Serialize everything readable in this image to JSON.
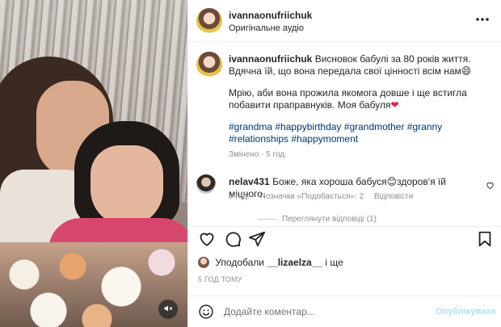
{
  "post": {
    "username": "ivannaonufriichuk",
    "audio": "Оригінальне аудіо",
    "caption_line1": "Висновок бабулі за 80 років життя. Вдячна їй, що вона передала свої цінності всім нам😄",
    "caption_line2": "Мрію, аби вона прожила якомога довше і ще встигла побавити праправнуків. Моя бабуля",
    "hashtags": "#grandma #happybirthday #grandmother #granny #relationships #happymoment",
    "edited": "Змінено · 5 год."
  },
  "comment": {
    "username": "nelav431",
    "text": "Боже, яка хороша бабуся😊здоров'я їй міцного.",
    "time": "4 год.",
    "likes": "Позначки «Подобається»: 2",
    "reply": "Відповісти",
    "view_replies": "Переглянути відповіді (1)"
  },
  "likes": {
    "prefix": "Уподобали",
    "user": "__lizaelza__",
    "suffix": "і ще"
  },
  "time_ago": "5 ГОД ТОМУ",
  "add_comment": {
    "placeholder": "Додайте коментар...",
    "publish": "Опублікувати"
  },
  "icons": {
    "more": "more-horizontal-icon",
    "mute": "muted-speaker-icon",
    "like": "heart-outline-icon",
    "comment": "comment-bubble-icon",
    "share": "paper-plane-icon",
    "save": "bookmark-icon",
    "emoji": "smiley-face-icon"
  },
  "colors": {
    "link": "#00376b",
    "heart": "#ed1c3b",
    "publish_disabled": "#b3dbff",
    "muted_text": "#8e8e8e"
  }
}
